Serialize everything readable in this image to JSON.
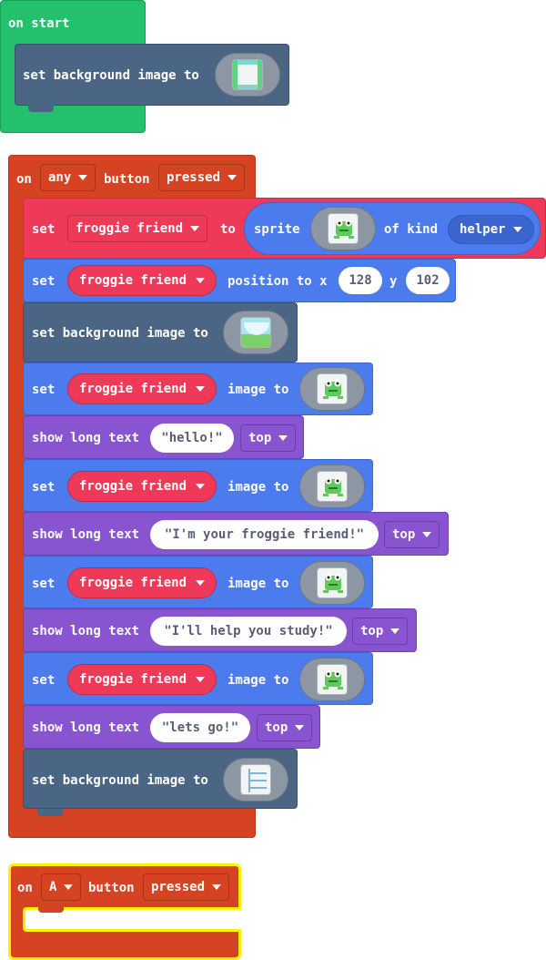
{
  "on_start": {
    "label": "on start",
    "set_bg": {
      "label": "set background image to",
      "thumb_icon": "tilemap-border-icon"
    }
  },
  "button_event": {
    "label_on": "on",
    "button_value": "any",
    "label_button": "button",
    "event_value": "pressed",
    "statements": [
      {
        "kind": "create_sprite",
        "label_set": "set",
        "variable": "froggie friend",
        "label_to": "to",
        "label_sprite": "sprite",
        "label_kind": "of kind",
        "kind_value": "helper",
        "thumb_icon": "frog-sprite-icon"
      },
      {
        "kind": "position",
        "label_set": "set",
        "variable": "froggie friend",
        "label_position": "position to x",
        "x": "128",
        "label_y": "y",
        "y": "102"
      },
      {
        "kind": "background",
        "label": "set background image to",
        "thumb_icon": "landscape-background-icon"
      },
      {
        "kind": "image",
        "label_set": "set",
        "variable": "froggie friend",
        "label_image": "image to",
        "thumb_icon": "frog-sprite-icon"
      },
      {
        "kind": "text",
        "label": "show long text",
        "text": "hello!",
        "position": "top"
      },
      {
        "kind": "image",
        "label_set": "set",
        "variable": "froggie friend",
        "label_image": "image to",
        "thumb_icon": "frog-sprite-icon"
      },
      {
        "kind": "text",
        "label": "show long text",
        "text": "I'm your froggie friend!",
        "position": "top"
      },
      {
        "kind": "image",
        "label_set": "set",
        "variable": "froggie friend",
        "label_image": "image to",
        "thumb_icon": "frog-sprite-icon"
      },
      {
        "kind": "text",
        "label": "show long text",
        "text": "I'll help you study!",
        "position": "top"
      },
      {
        "kind": "image",
        "label_set": "set",
        "variable": "froggie friend",
        "label_image": "image to",
        "thumb_icon": "frog-sprite-icon"
      },
      {
        "kind": "text",
        "label": "show long text",
        "text": "lets go!",
        "position": "top"
      },
      {
        "kind": "background",
        "label": "set background image to",
        "thumb_icon": "menu-background-icon"
      }
    ]
  },
  "a_button_event": {
    "label_on": "on",
    "button_value": "A",
    "label_button": "button",
    "event_value": "pressed"
  },
  "colors": {
    "loops_green": "#23c16e",
    "controller_orange": "#d54322",
    "sprites_blue": "#4b7bec",
    "scene_slate": "#4b6584",
    "game_purple": "#8854d0",
    "variable_red": "#ee3958",
    "selected_yellow": "#fff200"
  }
}
